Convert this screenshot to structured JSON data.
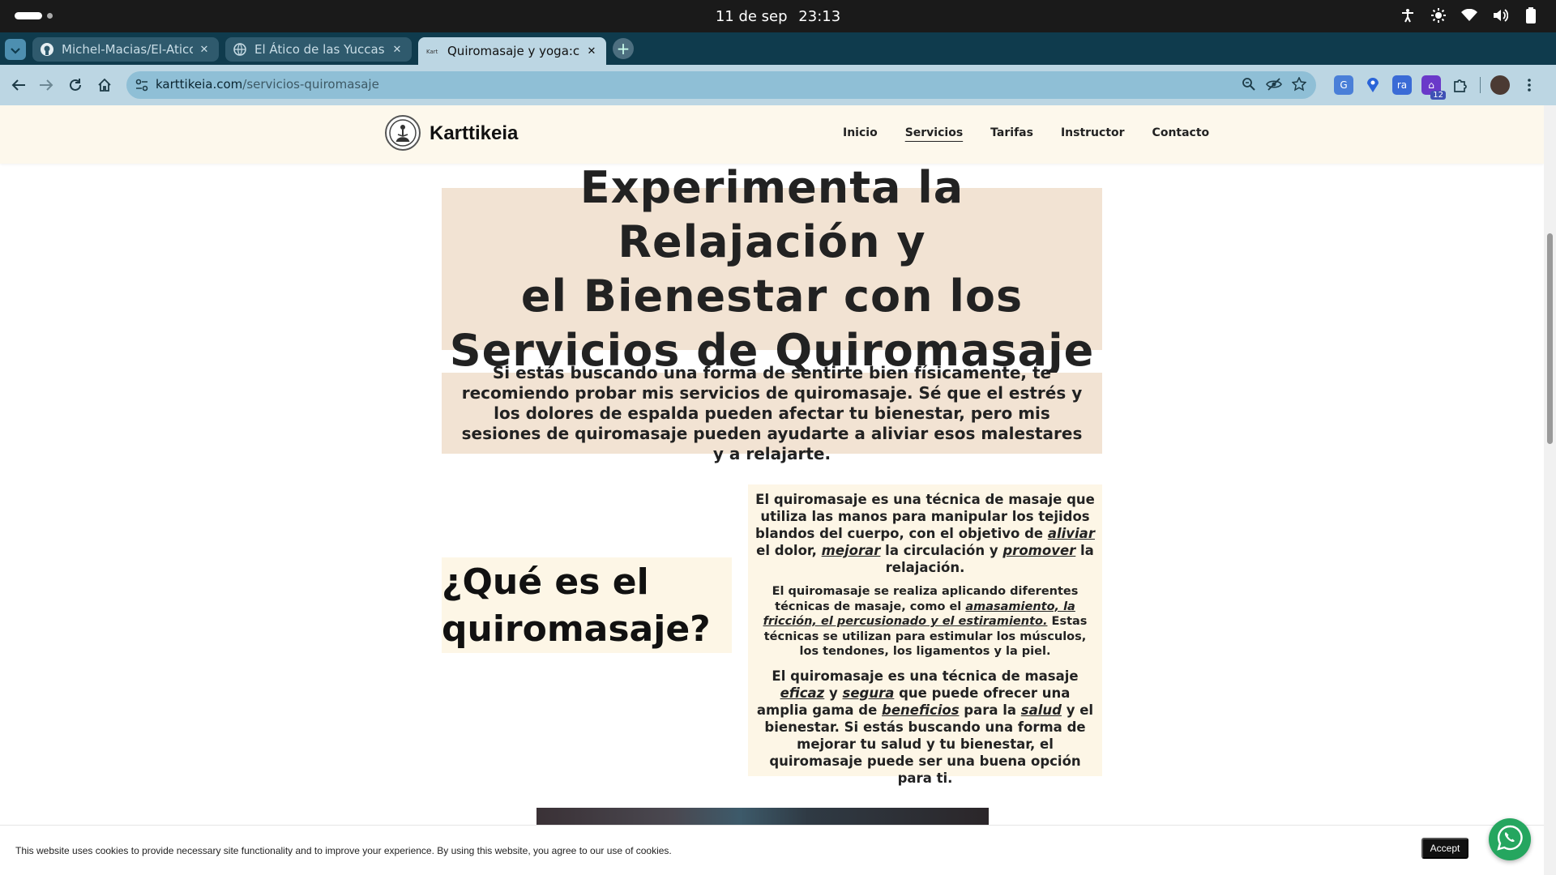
{
  "os": {
    "date": "11 de sep",
    "time": "23:13"
  },
  "browser": {
    "tabs": [
      {
        "title": "Michel-Macias/El-Atico-de-las-Yuccas",
        "favicon": "github-icon",
        "active": false
      },
      {
        "title": "El Ático de las Yuccas - Yoga",
        "favicon": "globe-icon",
        "active": false
      },
      {
        "title": "Quiromasaje y yoga:cardio",
        "favicon": "karttikeia-favicon",
        "active": true
      }
    ],
    "url_domain": "karttikeia.com",
    "url_path": "/servicios-quiromasaje",
    "extension_badge": "12"
  },
  "site": {
    "brand": "Karttikeia",
    "nav": [
      {
        "label": "Inicio",
        "current": false
      },
      {
        "label": "Servicios",
        "current": true
      },
      {
        "label": "Tarifas",
        "current": false
      },
      {
        "label": "Instructor",
        "current": false
      },
      {
        "label": "Contacto",
        "current": false
      }
    ]
  },
  "hero": {
    "heading_lines": [
      "Experimenta la Relajación y",
      "el Bienestar con los",
      "Servicios de Quiromasaje"
    ]
  },
  "intro": {
    "text": "Si estás buscando una forma de sentirte bien físicamente, te recomiendo probar mis servicios de quiromasaje. Sé que el estrés y los dolores de espalda pueden afectar tu bienestar, pero mis sesiones de quiromasaje pueden ayudarte a aliviar esos malestares y a relajarte."
  },
  "section": {
    "heading_lines": [
      "¿Qué es el",
      "quiromasaje?"
    ],
    "p1": {
      "a": "El quiromasaje es una técnica de masaje que utiliza las manos para manipular los tejidos blandos del cuerpo, con el objetivo de ",
      "k1": "aliviar",
      "b": " el dolor, ",
      "k2": "mejorar",
      "c": "  la circulación y ",
      "k3": "promover",
      "d": " la relajación."
    },
    "p2": {
      "a": "El quiromasaje se realiza aplicando diferentes técnicas de masaje, como el ",
      "k1": "amasamiento, la fricción, el percusionado y el estiramiento.",
      "b": " Estas técnicas se utilizan para estimular los músculos, los tendones, los ligamentos y la piel."
    },
    "p3": {
      "a": "El quiromasaje es una técnica de masaje ",
      "k1": "eficaz",
      "b": " y ",
      "k2": "segura",
      "c": " que puede ofrecer una amplia gama de ",
      "k3": "beneficios",
      "d": " para la ",
      "k4": "salud",
      "e": " y el bienestar. Si estás buscando una forma de mejorar tu salud y tu bienestar, el quiromasaje puede ser una buena opción para ti."
    }
  },
  "cookie": {
    "text": "This website uses cookies to provide necessary site functionality and to improve your experience. By using this website, you agree to our use of cookies.",
    "accept_label": "Accept"
  }
}
